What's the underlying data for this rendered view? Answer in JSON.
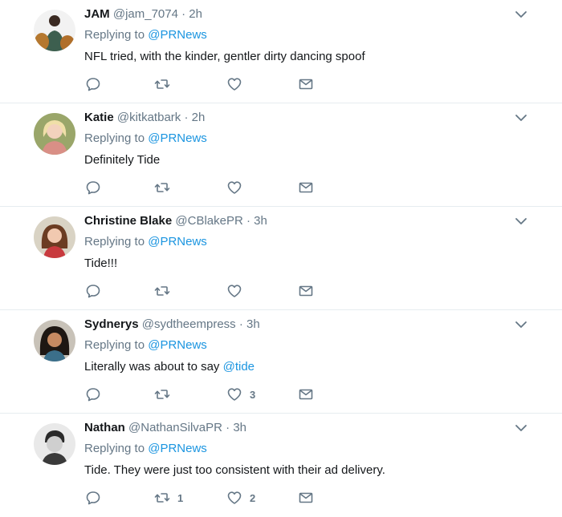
{
  "icons": {
    "reply": "reply-icon",
    "retweet": "retweet-icon",
    "like": "heart-icon",
    "dm": "envelope-icon",
    "more": "chevron-down-icon"
  },
  "colors": {
    "link": "#1b95e0",
    "muted": "#657786",
    "text": "#14171a",
    "divider": "#e6ecf0"
  },
  "tweets": [
    {
      "name": "JAM",
      "handle": "@jam_7074",
      "sep": "·",
      "time": "2h",
      "replying_prefix": "Replying to",
      "replying_to": "@PRNews",
      "text": "NFL tried, with the kinder, gentler dirty dancing spoof",
      "text_mention": "",
      "retweets": "",
      "likes": ""
    },
    {
      "name": "Katie",
      "handle": "@kitkatbark",
      "sep": "·",
      "time": "2h",
      "replying_prefix": "Replying to",
      "replying_to": "@PRNews",
      "text": "Definitely Tide",
      "text_mention": "",
      "retweets": "",
      "likes": ""
    },
    {
      "name": "Christine Blake",
      "handle": "@CBlakePR",
      "sep": "·",
      "time": "3h",
      "replying_prefix": "Replying to",
      "replying_to": "@PRNews",
      "text": "Tide!!!",
      "text_mention": "",
      "retweets": "",
      "likes": ""
    },
    {
      "name": "Sydnerys",
      "handle": "@sydtheempress",
      "sep": "·",
      "time": "3h",
      "replying_prefix": "Replying to",
      "replying_to": "@PRNews",
      "text": "Literally was about to say ",
      "text_mention": "@tide",
      "retweets": "",
      "likes": "3"
    },
    {
      "name": "Nathan",
      "handle": "@NathanSilvaPR",
      "sep": "·",
      "time": "3h",
      "replying_prefix": "Replying to",
      "replying_to": "@PRNews",
      "text": "Tide. They were just too consistent with their ad delivery.",
      "text_mention": "",
      "retweets": "1",
      "likes": "2"
    }
  ]
}
